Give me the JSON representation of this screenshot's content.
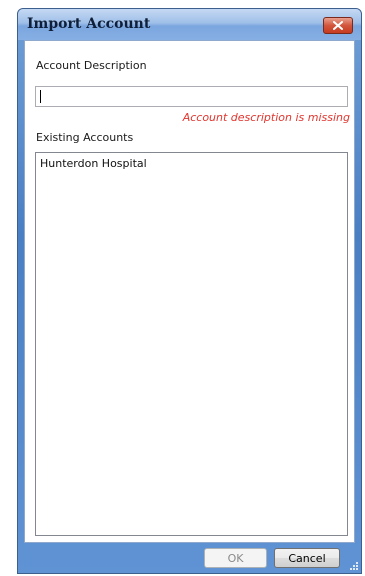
{
  "window": {
    "title": "Import Account"
  },
  "form": {
    "description_label": "Account Description",
    "description_value": "",
    "error_message": "Account description is missing",
    "existing_label": "Existing Accounts",
    "existing_accounts": [
      "Hunterdon Hospital"
    ]
  },
  "buttons": {
    "ok_label": "OK",
    "cancel_label": "Cancel"
  },
  "icons": {
    "close": "close-icon",
    "resize": "resize-grip-icon"
  },
  "colors": {
    "error": "#e0362f",
    "titlebar": "#9fbfe8",
    "close": "#d2553c"
  }
}
